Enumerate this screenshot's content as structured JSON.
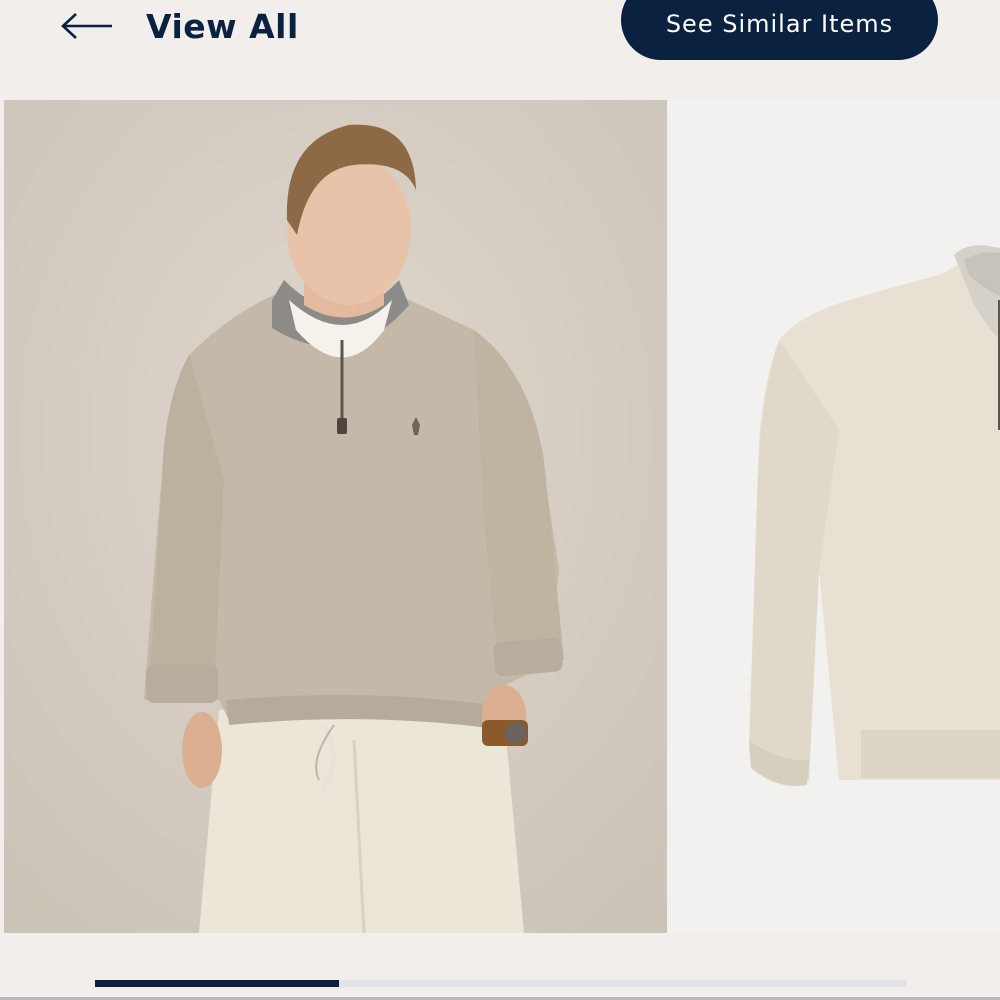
{
  "header": {
    "back_label": "View All",
    "similar_button_label": "See Similar Items"
  },
  "icons": {
    "back": "arrow-left-icon"
  },
  "carousel": {
    "slides": [
      {
        "name": "model-photo",
        "description_hidden": true
      },
      {
        "name": "product-flat-photo",
        "description_hidden": true
      }
    ],
    "progress": 0.3
  },
  "colors": {
    "navy": "#0b2140",
    "page_bg": "#f1eeeb",
    "track": "#e2e3e8"
  }
}
